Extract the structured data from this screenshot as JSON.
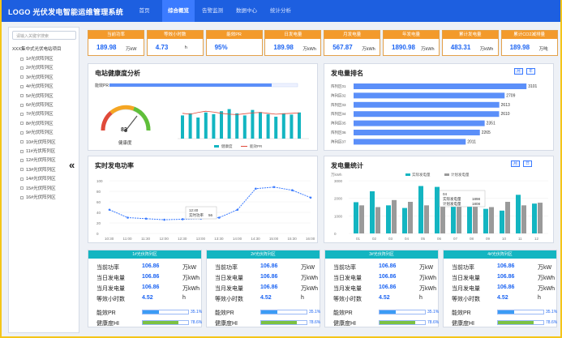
{
  "app_title": "LOGO 光伏发电智能运维管理系统",
  "nav": [
    "首页",
    "综合概览",
    "告警监测",
    "数据中心",
    "统计分析"
  ],
  "nav_active": 1,
  "sidebar": {
    "search_placeholder": "请输入关键字搜索",
    "root": "XXX集中式光伏电站项目",
    "items": [
      "1#光伏阵列区",
      "2#光伏阵列区",
      "3#光伏阵列区",
      "4#光伏阵列区",
      "5#光伏阵列区",
      "6#光伏阵列区",
      "7#光伏阵列区",
      "8#光伏阵列区",
      "9#光伏阵列区",
      "10#光伏阵列区",
      "11#光伏阵列区",
      "12#光伏阵列区",
      "13#光伏阵列区",
      "14#光伏阵列区",
      "15#光伏阵列区",
      "16#光伏阵列区"
    ]
  },
  "kpis": [
    {
      "label": "当前功率",
      "value": "189.98",
      "unit": "万kW"
    },
    {
      "label": "等效小时数",
      "value": "4.73",
      "unit": "h"
    },
    {
      "label": "能效PR",
      "value": "95%",
      "unit": ""
    },
    {
      "label": "日发电量",
      "value": "189.98",
      "unit": "万kWh"
    },
    {
      "label": "月发电量",
      "value": "567.87",
      "unit": "万kWh"
    },
    {
      "label": "年发电量",
      "value": "1890.98",
      "unit": "万kWh"
    },
    {
      "label": "累计发电量",
      "value": "483.31",
      "unit": "万kWh"
    },
    {
      "label": "累计CO2减排量",
      "value": "189.98",
      "unit": "万吨"
    }
  ],
  "health": {
    "title": "电站健康度分析",
    "score": "83",
    "score_label": "健康度",
    "top_bar_label": "能效PR",
    "legend": [
      "健康度",
      "能效PR"
    ],
    "gauge_ticks": [
      "0",
      "20",
      "40",
      "60",
      "80",
      "100"
    ]
  },
  "ranking": {
    "title": "发电量排名",
    "toggles": [
      "月",
      "年"
    ],
    "categories": [
      "阵列区01",
      "阵列区02",
      "阵列区03",
      "阵列区04",
      "阵列区05",
      "阵列区06",
      "阵列区07"
    ],
    "values": [
      3101,
      2709,
      2613,
      2610,
      2351,
      2265,
      2011
    ]
  },
  "realtime": {
    "title": "实时发电功率",
    "x": [
      "10:30",
      "11:00",
      "11:30",
      "12:00",
      "12:30",
      "13:00",
      "13:30",
      "14:00",
      "14:30",
      "15:00",
      "15:30",
      "16:00"
    ],
    "y_ticks": [
      "0",
      "20",
      "40",
      "60",
      "80",
      "100"
    ],
    "tooltip_time": "12:40",
    "tooltip_label": "实时功率",
    "tooltip_value": "56"
  },
  "stats": {
    "title": "发电量统计",
    "toggles": [
      "月",
      "日"
    ],
    "ylabel": "万kWh",
    "legend": [
      "实际发电量",
      "计划发电量"
    ],
    "tooltip": {
      "title": "04",
      "a_label": "实际发电量",
      "a_value": "1898",
      "b_label": "计划发电量",
      "b_value": "1808"
    }
  },
  "arrays": [
    {
      "title": "1#光伏阵列区",
      "power": "106.86",
      "day": "106.86",
      "month": "106.86",
      "hours": "4.52",
      "pr": "35.1%",
      "pr_frac": 0.35,
      "hi": "78.6%",
      "hi_frac": 0.786
    },
    {
      "title": "2#光伏阵列区",
      "power": "106.86",
      "day": "106.86",
      "month": "106.86",
      "hours": "4.52",
      "pr": "35.1%",
      "pr_frac": 0.35,
      "hi": "78.6%",
      "hi_frac": 0.786
    },
    {
      "title": "3#光伏阵列区",
      "power": "106.86",
      "day": "106.86",
      "month": "106.86",
      "hours": "4.52",
      "pr": "35.1%",
      "pr_frac": 0.35,
      "hi": "78.6%",
      "hi_frac": 0.786
    },
    {
      "title": "4#光伏阵列区",
      "power": "106.86",
      "day": "106.86",
      "month": "106.86",
      "hours": "4.52",
      "pr": "35.1%",
      "pr_frac": 0.35,
      "hi": "78.6%",
      "hi_frac": 0.786
    }
  ],
  "array_labels": {
    "power": "当前功率",
    "day": "当日发电量",
    "month": "当月发电量",
    "hours": "等效小时数",
    "pr": "能效PR",
    "hi": "健康度HI"
  },
  "array_units": {
    "power": "万kW",
    "day": "万kWh",
    "month": "万kWh",
    "hours": "h"
  },
  "colors": {
    "brand": "#1d5fe0",
    "kpi_header": "#f39a2b",
    "teal": "#13b5c1",
    "bar_blue": "#5b8ff9",
    "gray_bar": "#9a9a9a",
    "green": "#7cc242"
  },
  "chart_data": [
    {
      "type": "bar",
      "title": "发电量排名",
      "categories": [
        "阵列区01",
        "阵列区02",
        "阵列区03",
        "阵列区04",
        "阵列区05",
        "阵列区06",
        "阵列区07"
      ],
      "values": [
        3101,
        2709,
        2613,
        2610,
        2351,
        2265,
        2011
      ]
    },
    {
      "type": "line",
      "title": "实时发电功率",
      "x": [
        "10:30",
        "11:00",
        "11:30",
        "12:00",
        "12:30",
        "13:00",
        "13:30",
        "14:00",
        "14:30",
        "15:00",
        "15:30",
        "16:00"
      ],
      "values": [
        45,
        30,
        28,
        26,
        27,
        28,
        30,
        45,
        85,
        88,
        82,
        68
      ],
      "ylim": [
        0,
        100
      ]
    },
    {
      "type": "bar",
      "title": "发电量统计",
      "categories": [
        "01",
        "02",
        "03",
        "04",
        "05",
        "06",
        "07",
        "08",
        "09",
        "10",
        "11",
        "12"
      ],
      "series": [
        {
          "name": "实际发电量",
          "values": [
            1780,
            2400,
            1600,
            1450,
            2700,
            2650,
            2100,
            1750,
            1400,
            1300,
            2200,
            1700
          ]
        },
        {
          "name": "计划发电量",
          "values": [
            1600,
            1500,
            1900,
            1800,
            1600,
            1700,
            2200,
            1650,
            1500,
            1800,
            1600,
            1750
          ]
        }
      ],
      "ylim": [
        0,
        3000
      ]
    },
    {
      "type": "bar",
      "title": "电站健康度分析",
      "categories": [
        "1",
        "2",
        "3",
        "4",
        "5",
        "6",
        "7",
        "8",
        "9",
        "10",
        "11",
        "12",
        "13",
        "14",
        "15",
        "16"
      ],
      "series": [
        {
          "name": "健康度",
          "values": [
            55,
            60,
            50,
            62,
            58,
            65,
            70,
            60,
            55,
            68,
            63,
            58,
            52,
            60,
            57,
            62
          ]
        },
        {
          "name": "能效PR",
          "values": [
            60,
            58,
            62,
            65,
            63,
            60,
            58,
            57,
            59,
            61,
            62,
            60,
            58,
            59,
            60,
            61
          ]
        }
      ],
      "ylim": [
        0,
        100
      ]
    }
  ]
}
